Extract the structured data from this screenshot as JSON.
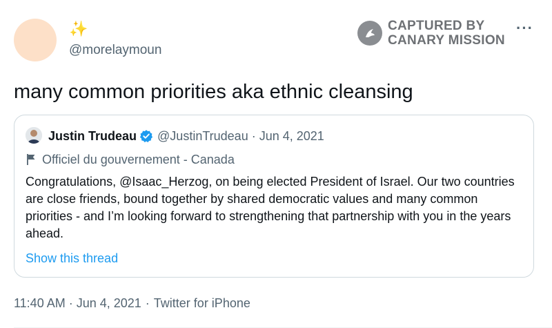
{
  "tweet": {
    "display_name": "✨",
    "handle": "@morelaymoun",
    "text": "many common priorities aka ethnic cleansing",
    "more_icon": "more-horizontal-icon",
    "timestamp": "11:40 AM · Jun 4, 2021",
    "time": "11:40 AM",
    "date": "Jun 4, 2021",
    "source": "Twitter for iPhone"
  },
  "watermark": {
    "line1": "CAPTURED BY",
    "line2": "CANARY MISSION"
  },
  "quoted": {
    "name": "Justin Trudeau",
    "handle": "@JustinTrudeau",
    "date": "Jun 4, 2021",
    "label": "Officiel du gouvernement - Canada",
    "body": "Congratulations, @Isaac_Herzog, on being elected President of Israel. Our two countries are close friends, bound together by shared democratic values and many common priorities - and I’m looking forward to strengthening that partnership with you in the years ahead.",
    "show_thread": "Show this thread"
  },
  "colors": {
    "accent": "#1d9bf0",
    "secondary_text": "#536471",
    "border": "#cfd9de",
    "verified": "#1d9bf0"
  }
}
